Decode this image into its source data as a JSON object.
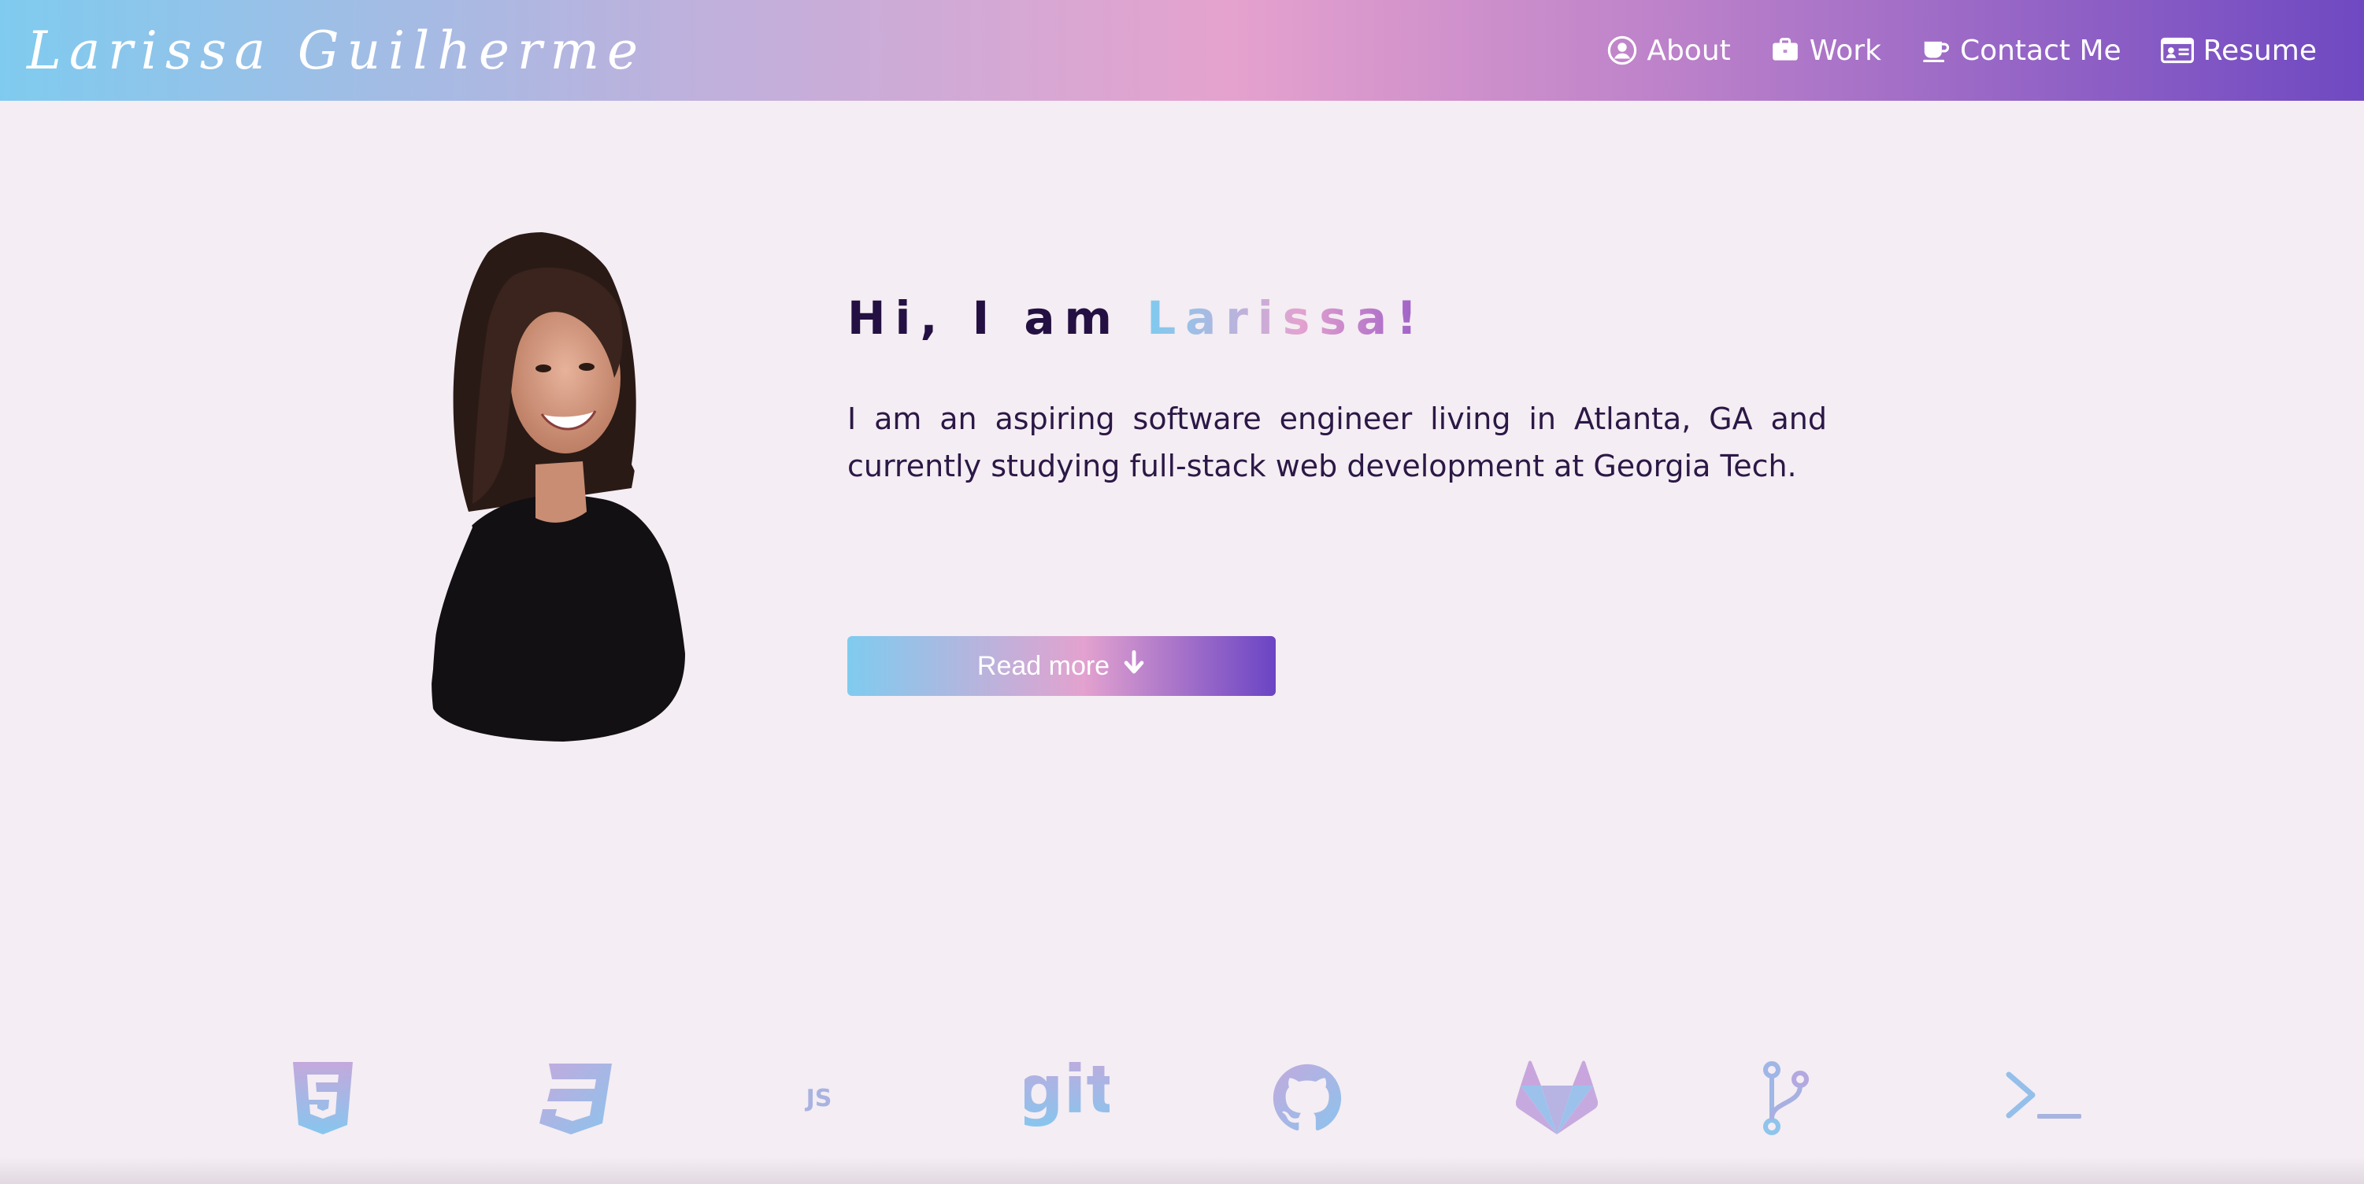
{
  "header": {
    "brand": "Larissa Guilherme",
    "nav": [
      {
        "label": "About",
        "icon": "user-circle-icon"
      },
      {
        "label": "Work",
        "icon": "briefcase-icon"
      },
      {
        "label": "Contact Me",
        "icon": "coffee-cup-icon"
      },
      {
        "label": "Resume",
        "icon": "id-card-icon"
      }
    ]
  },
  "hero": {
    "greeting_prefix": "Hi, I am ",
    "greeting_name": "Larissa!",
    "intro": "I am an aspiring software engineer living in Atlanta, GA and currently studying full-stack web development at Georgia Tech.",
    "read_more_label": "Read more"
  },
  "tech_icons": [
    {
      "name": "html5-icon"
    },
    {
      "name": "css3-icon"
    },
    {
      "name": "javascript-icon",
      "text": "JS"
    },
    {
      "name": "git-icon",
      "text": "git"
    },
    {
      "name": "github-icon"
    },
    {
      "name": "gitlab-icon"
    },
    {
      "name": "code-branch-icon"
    },
    {
      "name": "terminal-icon"
    }
  ],
  "colors": {
    "gradient_start": "#7fcbef",
    "gradient_mid": "#e5a2ce",
    "gradient_end": "#6f49c2",
    "background": "#f4edf3",
    "text_dark": "#241042"
  }
}
